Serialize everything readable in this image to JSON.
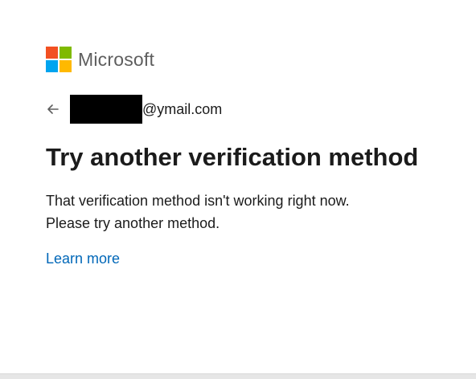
{
  "brand": {
    "logo_colors": [
      "#f25022",
      "#7fba00",
      "#00a4ef",
      "#ffb900"
    ],
    "name": "Microsoft"
  },
  "identity": {
    "back_icon": "arrow-left-icon",
    "email_suffix": "@ymail.com"
  },
  "content": {
    "title": "Try another verification method",
    "message_lines": [
      "That verification method isn't working right now.",
      "Please try another method."
    ],
    "link_label": "Learn more"
  },
  "colors": {
    "link": "#0067b8",
    "text": "#1b1b1b",
    "brand_text": "#5e5e5e"
  }
}
